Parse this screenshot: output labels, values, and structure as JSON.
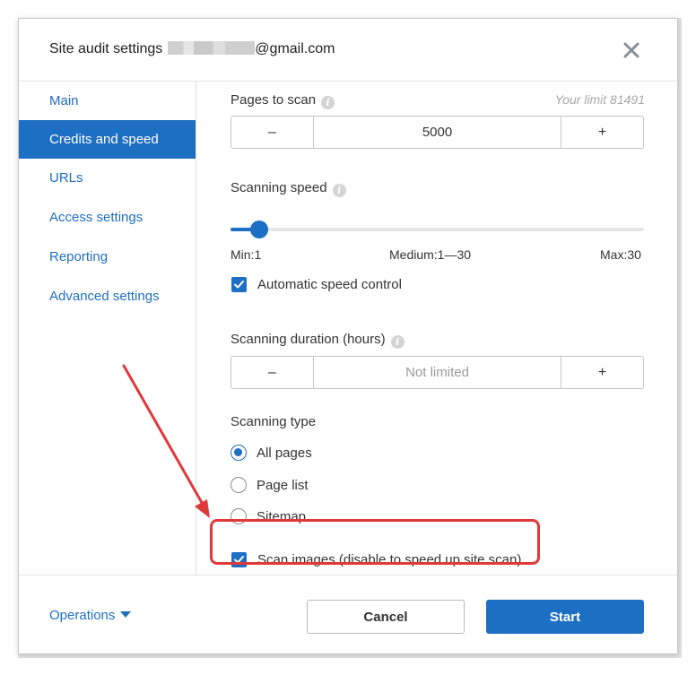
{
  "dialog": {
    "title": "Site audit settings",
    "email_suffix": "@gmail.com"
  },
  "sidebar": {
    "items": [
      {
        "label": "Main"
      },
      {
        "label": "Credits and speed",
        "active": true
      },
      {
        "label": "URLs"
      },
      {
        "label": "Access settings"
      },
      {
        "label": "Reporting"
      },
      {
        "label": "Advanced settings"
      }
    ]
  },
  "pages_to_scan": {
    "label": "Pages to scan",
    "limit_text": "Your limit 81491",
    "decrement": "–",
    "value": "5000",
    "increment": "+"
  },
  "scanning_speed": {
    "label": "Scanning speed",
    "current_value": 1,
    "min_label": "Min:1",
    "medium_label": "Medium:1—30",
    "max_label": "Max:30",
    "auto_control_label": "Automatic speed control",
    "auto_control_checked": true
  },
  "scanning_duration": {
    "label": "Scanning duration (hours)",
    "decrement": "–",
    "value": "Not limited",
    "increment": "+"
  },
  "scanning_type": {
    "label": "Scanning type",
    "options": [
      {
        "label": "All pages",
        "selected": true
      },
      {
        "label": "Page list",
        "selected": false
      },
      {
        "label": "Sitemap",
        "selected": false
      }
    ]
  },
  "scan_images": {
    "label": "Scan images (disable to speed up site scan)",
    "checked": true
  },
  "footer": {
    "operations_label": "Operations",
    "cancel_label": "Cancel",
    "start_label": "Start"
  },
  "colors": {
    "accent": "#1d6fc4",
    "link": "#1f6fc0",
    "annotation": "#e0393b"
  },
  "icons": {
    "close": "close-icon",
    "info": "info-icon",
    "caret": "caret-down-icon"
  }
}
